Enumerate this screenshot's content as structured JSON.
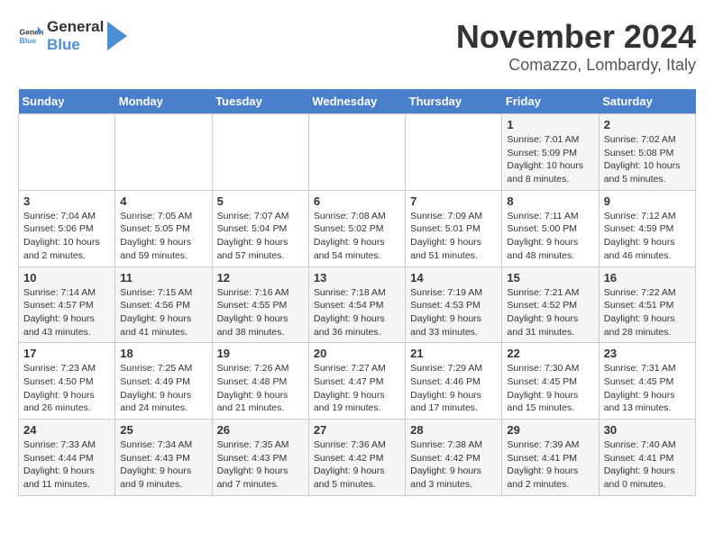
{
  "header": {
    "logo_general": "General",
    "logo_blue": "Blue",
    "month_year": "November 2024",
    "location": "Comazzo, Lombardy, Italy"
  },
  "weekdays": [
    "Sunday",
    "Monday",
    "Tuesday",
    "Wednesday",
    "Thursday",
    "Friday",
    "Saturday"
  ],
  "weeks": [
    [
      {
        "day": "",
        "info": ""
      },
      {
        "day": "",
        "info": ""
      },
      {
        "day": "",
        "info": ""
      },
      {
        "day": "",
        "info": ""
      },
      {
        "day": "",
        "info": ""
      },
      {
        "day": "1",
        "info": "Sunrise: 7:01 AM\nSunset: 5:09 PM\nDaylight: 10 hours and 8 minutes."
      },
      {
        "day": "2",
        "info": "Sunrise: 7:02 AM\nSunset: 5:08 PM\nDaylight: 10 hours and 5 minutes."
      }
    ],
    [
      {
        "day": "3",
        "info": "Sunrise: 7:04 AM\nSunset: 5:06 PM\nDaylight: 10 hours and 2 minutes."
      },
      {
        "day": "4",
        "info": "Sunrise: 7:05 AM\nSunset: 5:05 PM\nDaylight: 9 hours and 59 minutes."
      },
      {
        "day": "5",
        "info": "Sunrise: 7:07 AM\nSunset: 5:04 PM\nDaylight: 9 hours and 57 minutes."
      },
      {
        "day": "6",
        "info": "Sunrise: 7:08 AM\nSunset: 5:02 PM\nDaylight: 9 hours and 54 minutes."
      },
      {
        "day": "7",
        "info": "Sunrise: 7:09 AM\nSunset: 5:01 PM\nDaylight: 9 hours and 51 minutes."
      },
      {
        "day": "8",
        "info": "Sunrise: 7:11 AM\nSunset: 5:00 PM\nDaylight: 9 hours and 48 minutes."
      },
      {
        "day": "9",
        "info": "Sunrise: 7:12 AM\nSunset: 4:59 PM\nDaylight: 9 hours and 46 minutes."
      }
    ],
    [
      {
        "day": "10",
        "info": "Sunrise: 7:14 AM\nSunset: 4:57 PM\nDaylight: 9 hours and 43 minutes."
      },
      {
        "day": "11",
        "info": "Sunrise: 7:15 AM\nSunset: 4:56 PM\nDaylight: 9 hours and 41 minutes."
      },
      {
        "day": "12",
        "info": "Sunrise: 7:16 AM\nSunset: 4:55 PM\nDaylight: 9 hours and 38 minutes."
      },
      {
        "day": "13",
        "info": "Sunrise: 7:18 AM\nSunset: 4:54 PM\nDaylight: 9 hours and 36 minutes."
      },
      {
        "day": "14",
        "info": "Sunrise: 7:19 AM\nSunset: 4:53 PM\nDaylight: 9 hours and 33 minutes."
      },
      {
        "day": "15",
        "info": "Sunrise: 7:21 AM\nSunset: 4:52 PM\nDaylight: 9 hours and 31 minutes."
      },
      {
        "day": "16",
        "info": "Sunrise: 7:22 AM\nSunset: 4:51 PM\nDaylight: 9 hours and 28 minutes."
      }
    ],
    [
      {
        "day": "17",
        "info": "Sunrise: 7:23 AM\nSunset: 4:50 PM\nDaylight: 9 hours and 26 minutes."
      },
      {
        "day": "18",
        "info": "Sunrise: 7:25 AM\nSunset: 4:49 PM\nDaylight: 9 hours and 24 minutes."
      },
      {
        "day": "19",
        "info": "Sunrise: 7:26 AM\nSunset: 4:48 PM\nDaylight: 9 hours and 21 minutes."
      },
      {
        "day": "20",
        "info": "Sunrise: 7:27 AM\nSunset: 4:47 PM\nDaylight: 9 hours and 19 minutes."
      },
      {
        "day": "21",
        "info": "Sunrise: 7:29 AM\nSunset: 4:46 PM\nDaylight: 9 hours and 17 minutes."
      },
      {
        "day": "22",
        "info": "Sunrise: 7:30 AM\nSunset: 4:45 PM\nDaylight: 9 hours and 15 minutes."
      },
      {
        "day": "23",
        "info": "Sunrise: 7:31 AM\nSunset: 4:45 PM\nDaylight: 9 hours and 13 minutes."
      }
    ],
    [
      {
        "day": "24",
        "info": "Sunrise: 7:33 AM\nSunset: 4:44 PM\nDaylight: 9 hours and 11 minutes."
      },
      {
        "day": "25",
        "info": "Sunrise: 7:34 AM\nSunset: 4:43 PM\nDaylight: 9 hours and 9 minutes."
      },
      {
        "day": "26",
        "info": "Sunrise: 7:35 AM\nSunset: 4:43 PM\nDaylight: 9 hours and 7 minutes."
      },
      {
        "day": "27",
        "info": "Sunrise: 7:36 AM\nSunset: 4:42 PM\nDaylight: 9 hours and 5 minutes."
      },
      {
        "day": "28",
        "info": "Sunrise: 7:38 AM\nSunset: 4:42 PM\nDaylight: 9 hours and 3 minutes."
      },
      {
        "day": "29",
        "info": "Sunrise: 7:39 AM\nSunset: 4:41 PM\nDaylight: 9 hours and 2 minutes."
      },
      {
        "day": "30",
        "info": "Sunrise: 7:40 AM\nSunset: 4:41 PM\nDaylight: 9 hours and 0 minutes."
      }
    ]
  ]
}
